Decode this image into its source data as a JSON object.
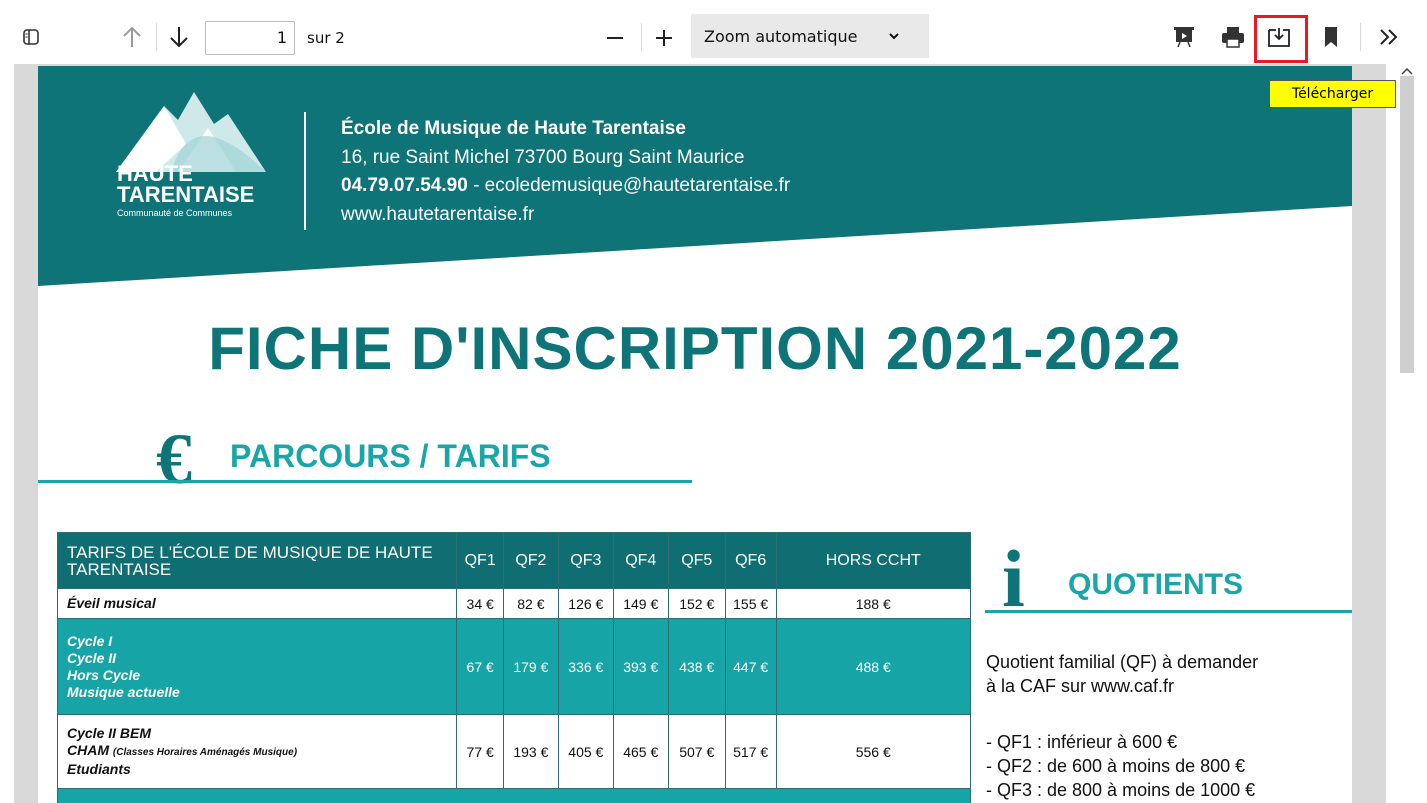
{
  "toolbar": {
    "page_value": "1",
    "page_total": "sur 2",
    "zoom_label": "Zoom automatique",
    "tooltip": "Télécharger"
  },
  "header": {
    "logo_line1": "HAUTE",
    "logo_line2": "TARENTAISE",
    "logo_sub": "Communauté de Communes",
    "school_name": "École de Musique de Haute Tarentaise",
    "address": "16, rue Saint Michel 73700 Bourg Saint Maurice",
    "phone": "04.79.07.54.90",
    "email": " - ecoledemusique@hautetarentaise.fr",
    "website": "www.hautetarentaise.fr"
  },
  "document": {
    "title": "FICHE D'INSCRIPTION 2021-2022",
    "section_tarifs": "PARCOURS / TARIFS",
    "section_quotients": "QUOTIENTS",
    "euro_symbol": "€",
    "info_symbol": "i"
  },
  "table": {
    "header_label": "TARIFS DE L'ÉCOLE DE MUSIQUE DE HAUTE TARENTAISE",
    "columns": [
      "QF1",
      "QF2",
      "QF3",
      "QF4",
      "QF5",
      "QF6",
      "HORS CCHT"
    ],
    "rows": [
      {
        "label": [
          "Éveil musical"
        ],
        "values": [
          "34 €",
          "82 €",
          "126 €",
          "149 €",
          "152 €",
          "155 €",
          "188 €"
        ]
      },
      {
        "label": [
          "Cycle I",
          "Cycle II",
          "Hors Cycle",
          "Musique actuelle"
        ],
        "values": [
          "67 €",
          "179 €",
          "336 €",
          "393 €",
          "438 €",
          "447 €",
          "488 €"
        ]
      },
      {
        "label": [
          "Cycle II BEM",
          "CHAM",
          "(Classes Horaires Aménagés Musique)",
          "Etudiants"
        ],
        "values": [
          "77 €",
          "193 €",
          "405 €",
          "465 €",
          "507 €",
          "517 €",
          "556 €"
        ]
      }
    ]
  },
  "quotients": {
    "intro_line1": "Quotient familial (QF) à demander",
    "intro_line2": "à la CAF sur www.caf.fr",
    "items": [
      "- QF1 : inférieur à 600 €",
      "- QF2 : de 600 à moins de 800 €",
      "- QF3 : de 800 à moins de 1000 €"
    ]
  },
  "colors": {
    "teal_dark": "#0e7478",
    "teal_light": "#17a4a6",
    "highlight_red": "#e51c23",
    "tooltip_yellow": "#ffff00"
  }
}
